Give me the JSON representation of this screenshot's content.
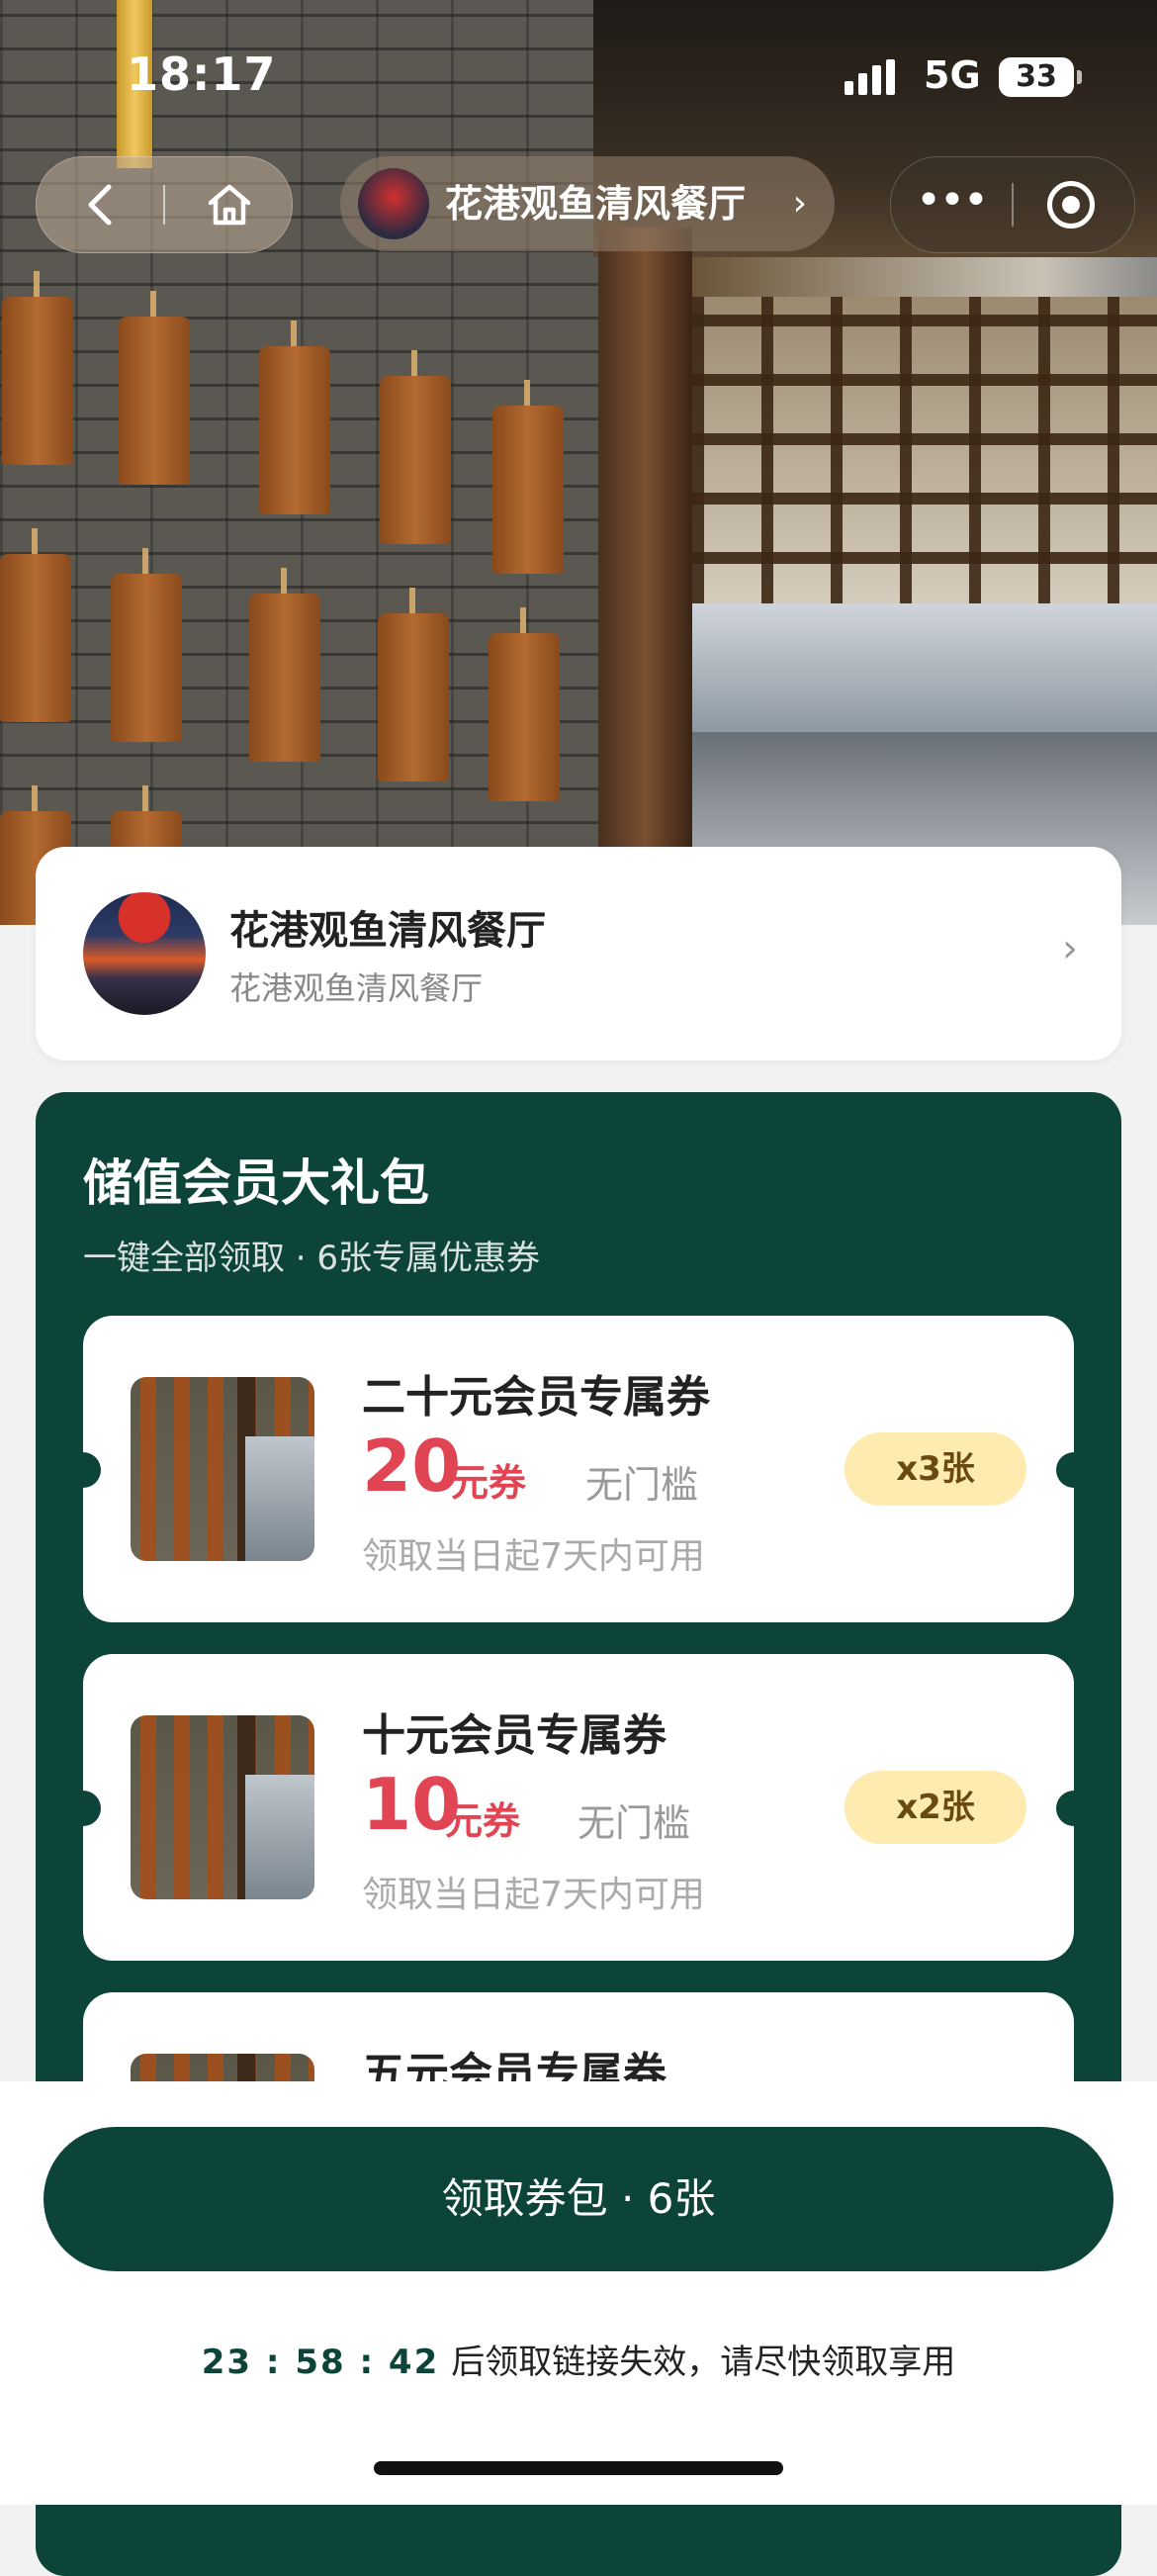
{
  "status_bar": {
    "time": "18:17",
    "network": "5G",
    "battery": "33"
  },
  "nav": {
    "back_icon": "back-icon",
    "home_icon": "home-icon",
    "title": "花港观鱼清风餐厅",
    "more_icon": "more-icon",
    "close_icon": "target-icon"
  },
  "store": {
    "name": "花港观鱼清风餐厅",
    "subtitle": "花港观鱼清风餐厅"
  },
  "package": {
    "title": "储值会员大礼包",
    "subtitle": "一键全部领取 · 6张专属优惠券",
    "coupons": [
      {
        "title": "二十元会员专属券",
        "amount": "20",
        "unit": "元券",
        "threshold": "无门槛",
        "validity": "领取当日起7天内可用",
        "quantity": "x3张"
      },
      {
        "title": "十元会员专属券",
        "amount": "10",
        "unit": "元券",
        "threshold": "无门槛",
        "validity": "领取当日起7天内可用",
        "quantity": "x2张"
      },
      {
        "title": "五元会员专属券"
      }
    ]
  },
  "footer": {
    "claim_label": "领取券包 · 6张",
    "countdown": "23 : 58 : 42",
    "countdown_text": "后领取链接失效，请尽快领取享用"
  },
  "colors": {
    "brand_green": "#0d4439",
    "price_red": "#e14452",
    "badge_yellow": "#fdebb0"
  }
}
